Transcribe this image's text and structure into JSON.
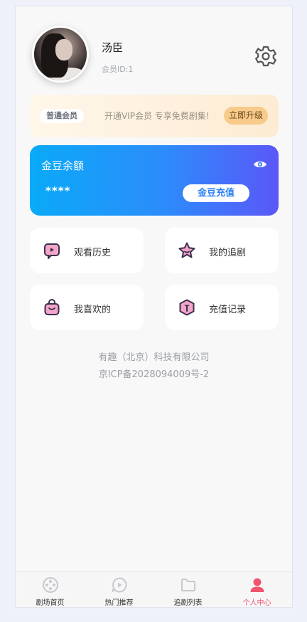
{
  "profile": {
    "username": "汤臣",
    "member_id": "会员ID:1"
  },
  "vip": {
    "badge": "普通会员",
    "promo_text": "开通VIP会员 专享免费剧集!",
    "upgrade_label": "立即升级"
  },
  "gold": {
    "title": "金豆余额",
    "amount": "****",
    "recharge_label": "金豆充值"
  },
  "menu": [
    {
      "label": "观看历史",
      "icon": "play-history-icon"
    },
    {
      "label": "我的追剧",
      "icon": "star-icon"
    },
    {
      "label": "我喜欢的",
      "icon": "bag-icon"
    },
    {
      "label": "充值记录",
      "icon": "recharge-record-icon"
    }
  ],
  "footer": {
    "company": "有趣（北京）科技有限公司",
    "icp": "京ICP备2028094009号-2"
  },
  "tabs": [
    {
      "label": "剧场首页",
      "icon": "film-reel-icon",
      "active": false
    },
    {
      "label": "热门推荐",
      "icon": "play-bubble-icon",
      "active": false
    },
    {
      "label": "追剧列表",
      "icon": "folder-icon",
      "active": false
    },
    {
      "label": "个人中心",
      "icon": "user-icon",
      "active": true
    }
  ],
  "colors": {
    "accent_gradient_start": "#0aaaf8",
    "accent_gradient_end": "#5b57f8",
    "active_tab": "#f0556e",
    "upgrade_button": "#f8cb8a",
    "menu_icon_fill": "#f3a6c8",
    "menu_icon_stroke": "#3c2f4d"
  }
}
